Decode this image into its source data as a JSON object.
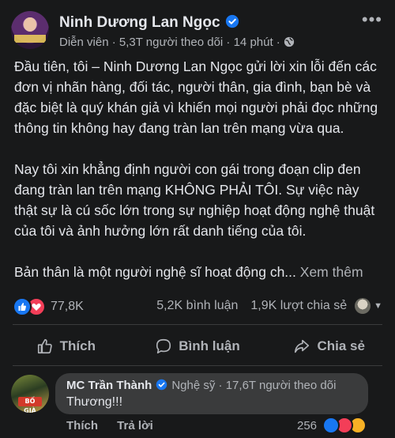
{
  "post": {
    "author": "Ninh Dương Lan Ngọc",
    "category": "Diễn viên",
    "followers": "5,3T người theo dõi",
    "time": "14 phút",
    "more_icon": "more-horizontal-icon",
    "paragraph_1": "Đầu tiên, tôi – Ninh Dương Lan Ngọc gửi lời xin lỗi đến các đơn vị nhãn hàng, đối tác, người thân, gia đình, bạn bè và đặc biệt là quý khán giả vì khiến mọi người phải đọc những thông tin không hay đang tràn lan trên mạng vừa qua.",
    "paragraph_2": "Nay tôi xin khẳng định người con gái trong đoạn clip đen đang tràn lan trên mạng KHÔNG PHẢI TÔI. Sự việc này thật sự là cú sốc lớn trong sự nghiệp hoạt động nghệ thuật của tôi và ảnh hưởng lớn rất danh tiếng của tôi.",
    "paragraph_3": "Bản thân là một người nghệ sĩ hoạt động ch...",
    "see_more": "Xem thêm"
  },
  "stats": {
    "reactions": "77,8K",
    "comments": "5,2K bình luận",
    "shares": "1,9K lượt chia sẻ"
  },
  "actions": {
    "like": "Thích",
    "comment": "Bình luận",
    "share": "Chia sẻ"
  },
  "comment": {
    "author": "MC Trần Thành",
    "category": "Nghệ sỹ",
    "followers": "17,6T người theo dõi",
    "text": "Thương!!!",
    "like": "Thích",
    "reply": "Trả lời",
    "reaction_count": "256"
  },
  "colors": {
    "background": "#18191a",
    "bubble": "#3a3b3c",
    "primary_text": "#e4e6eb",
    "secondary_text": "#b0b3b8",
    "like_blue": "#1877f2",
    "love_red": "#f33e58"
  }
}
